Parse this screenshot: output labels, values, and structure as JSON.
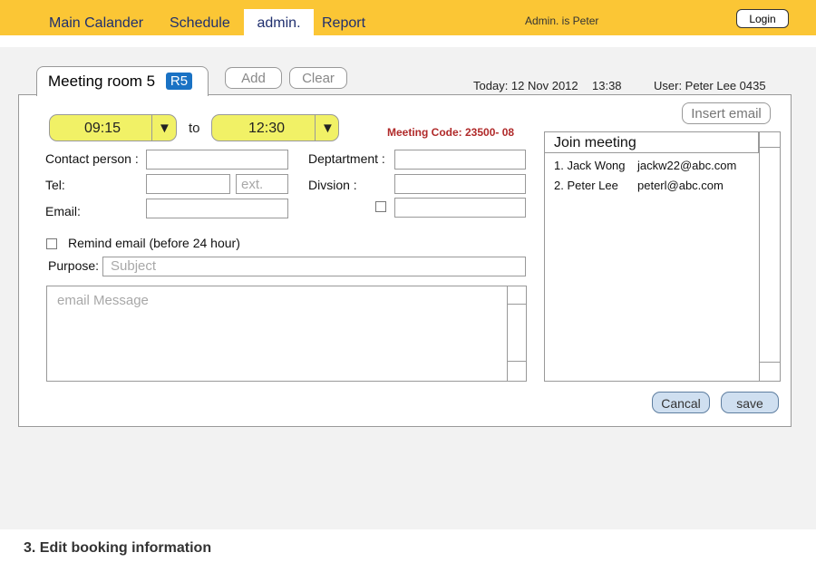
{
  "nav": {
    "items": [
      "Main Calander",
      "Schedule",
      "admin.",
      "Report"
    ],
    "admin_info": "Admin. is Peter",
    "login_label": "Login"
  },
  "tab": {
    "label": "Meeting room 5",
    "badge": "R5"
  },
  "toolbar": {
    "add_label": "Add",
    "clear_label": "Clear",
    "insert_email_label": "Insert email"
  },
  "meta": {
    "today": "Today: 12 Nov 2012",
    "time": "13:38",
    "user": "User:  Peter Lee  0435"
  },
  "form": {
    "start_time": "09:15",
    "end_time": "12:30",
    "to_label": "to",
    "meeting_code": "Meeting Code: 23500- 08",
    "contact_label": "Contact person :",
    "tel_label": "Tel:",
    "ext_placeholder": "ext.",
    "email_label": "Email:",
    "department_label": "Deptartment :",
    "division_label": "Divsion :",
    "remind_label": "Remind email (before 24 hour)",
    "purpose_label": "Purpose:",
    "subject_placeholder": "Subject",
    "message_placeholder": "email Message"
  },
  "join": {
    "title": "Join meeting",
    "attendees": [
      {
        "name": "1. Jack Wong",
        "email": "jackw22@abc.com"
      },
      {
        "name": "2. Peter Lee",
        "email": "peterl@abc.com"
      }
    ]
  },
  "actions": {
    "cancel_label": "Cancal",
    "save_label": "save"
  },
  "caption": "3. Edit booking information",
  "colors": {
    "topbar": "#fbc635",
    "time_select": "#f1f166",
    "badge": "#1a72c4",
    "code": "#b02a2a",
    "button": "#cfdff0"
  }
}
